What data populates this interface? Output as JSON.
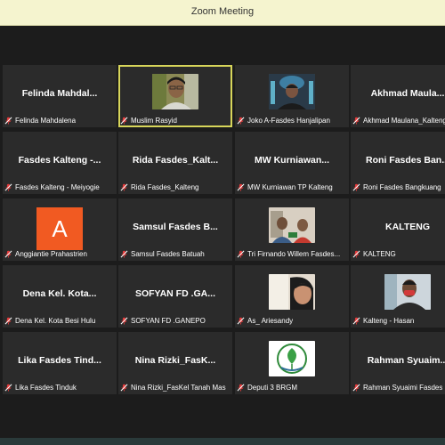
{
  "window": {
    "title": "Zoom Meeting"
  },
  "participants": [
    {
      "big": "Felinda  Mahdal...",
      "label": "Felinda Mahdalena"
    },
    {
      "big": "",
      "label": "Muslim Rasyid",
      "video": "person-glasses"
    },
    {
      "big": "",
      "label": "Joko A-Fasdes Hanjalipan",
      "video": "person-mosque"
    },
    {
      "big": "Akhmad  Maula...",
      "label": "Akhmad Maulana_Kalteng"
    },
    {
      "big": "Fasdes Kalteng -...",
      "label": "Fasdes Kalteng - Meiyogie"
    },
    {
      "big": "Rida  Fasdes_Kalt...",
      "label": "Rida Fasdes_Kalteng"
    },
    {
      "big": "MW  Kurniawan...",
      "label": "MW Kurniawan TP Kalteng"
    },
    {
      "big": "Roni  Fasdes  Ban...",
      "label": "Roni Fasdes Bangkuang"
    },
    {
      "big": "",
      "label": "Anggiantie Prahastrien",
      "avatar": "A"
    },
    {
      "big": "Samsul  Fasdes  B...",
      "label": "Samsul Fasdes Batuah"
    },
    {
      "big": "",
      "label": "Tri Firnando Willem Fasdes...",
      "video": "person-group"
    },
    {
      "big": "KALTENG",
      "label": "KALTENG"
    },
    {
      "big": "Dena  Kel.  Kota...",
      "label": "Dena Kel. Kota Besi Hulu"
    },
    {
      "big": "SOFYAN  FD  .GA...",
      "label": "SOFYAN FD .GANEPO"
    },
    {
      "big": "",
      "label": "As_ Ariesandy",
      "video": "person-face"
    },
    {
      "big": "",
      "label": "Kalteng - Hasan",
      "video": "person-mask"
    },
    {
      "big": "Lika  Fasdes  Tind...",
      "label": "Lika Fasdes Tinduk"
    },
    {
      "big": "Nina  Rizki_FasK...",
      "label": "Nina Rizki_FasKel Tanah Mas"
    },
    {
      "big": "",
      "label": "Deputi 3 BRGM",
      "video": "logo-leaf"
    },
    {
      "big": "Rahman  Syuaim...",
      "label": "Rahman Syuaimi Fasdes"
    }
  ],
  "active_index": 1,
  "colors": {
    "mute": "#e33b3b",
    "active_border": "#d7d55a",
    "avatar_bg": "#f15a22"
  }
}
